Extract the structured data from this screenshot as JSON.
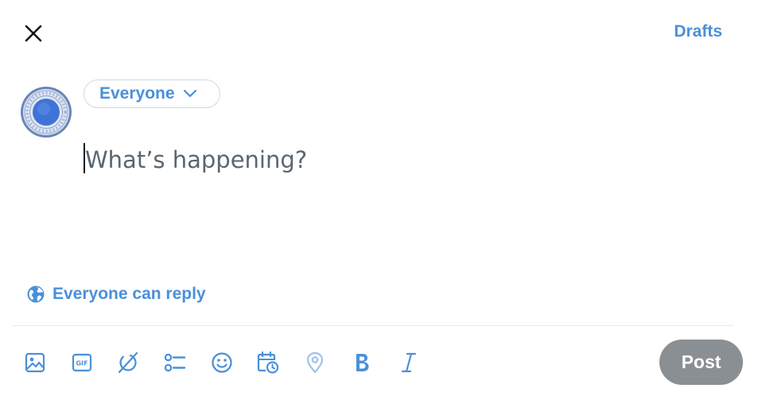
{
  "header": {
    "close_icon": "close-icon",
    "drafts_label": "Drafts"
  },
  "composer": {
    "avatar_icon": "avatar-icon",
    "audience_label": "Everyone",
    "placeholder": "What’s happening?",
    "value": "",
    "reply_setting_label": "Everyone can reply"
  },
  "toolbar": {
    "tools": [
      "media-icon",
      "gif-icon",
      "grok-icon",
      "poll-icon",
      "emoji-icon",
      "schedule-icon",
      "location-icon",
      "bold-icon",
      "italic-icon"
    ],
    "post_label": "Post"
  },
  "colors": {
    "accent": "#4a90d9",
    "post_button_disabled": "#8a8f94",
    "border": "#cfd9de",
    "placeholder": "#5b6670"
  }
}
